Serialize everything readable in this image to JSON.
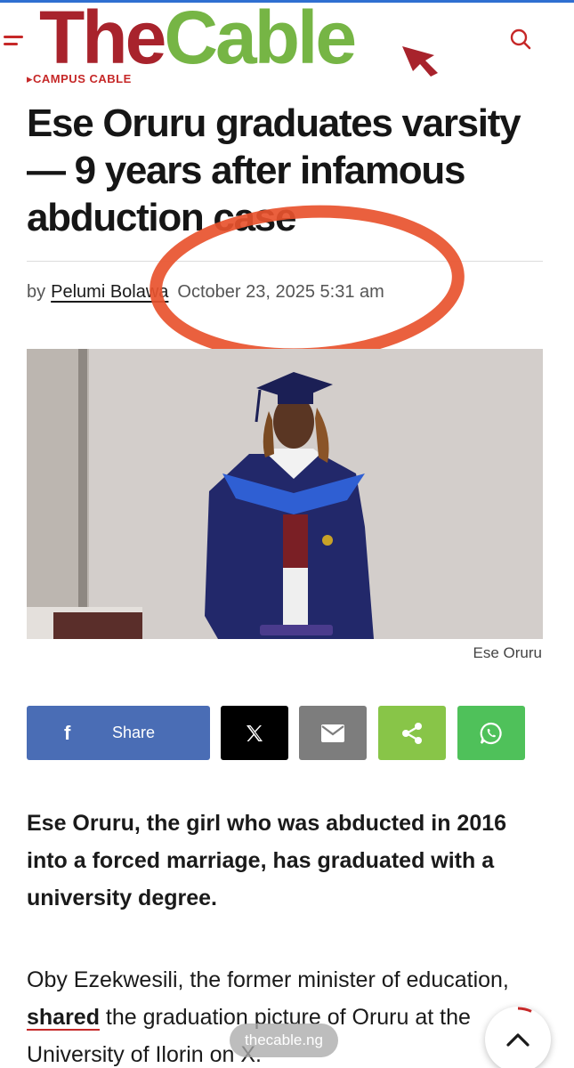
{
  "header": {
    "logo_the": "The",
    "logo_cable": "Cable",
    "menu_icon": "hamburger-icon",
    "search_icon": "search-icon"
  },
  "article": {
    "category": "CAMPUS CABLE",
    "headline": "Ese Oruru graduates varsity — 9 years after infamous abduction case",
    "byline_prefix": "by",
    "author": "Pelumi Bolawa",
    "date": "October 23, 2025 5:31 am",
    "image_caption": "Ese Oruru",
    "lead": "Ese Oruru, the girl who was abducted in 2016 into a forced marriage, has graduated with a university degree.",
    "body_part1": "Oby Ezekwesili, the former minister of education, ",
    "body_link": "shared",
    "body_part2": " the graduation picture of Oruru at the University of Ilorin on X."
  },
  "share": {
    "facebook_label": "Share",
    "icons": [
      "facebook-icon",
      "x-icon",
      "mail-icon",
      "share-icon",
      "whatsapp-icon"
    ]
  },
  "browser": {
    "domain": "thecable.ng"
  },
  "colors": {
    "brand_red": "#a8232c",
    "brand_green": "#76b545",
    "accent_red": "#c62828",
    "facebook": "#4a6db5",
    "x": "#000000",
    "mail": "#7d7d7d",
    "share": "#88c548",
    "whatsapp": "#4fc15a",
    "annotation_circle": "#e8522e"
  }
}
